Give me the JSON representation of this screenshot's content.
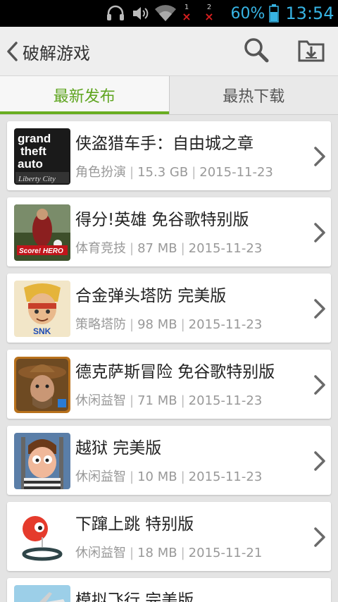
{
  "status_bar": {
    "battery_percent": "60%",
    "time": "13:54",
    "sim1_label": "1",
    "sim2_label": "2",
    "no_signal_mark": "×",
    "icons": [
      "headset-icon",
      "volume-icon",
      "wifi-icon",
      "sim-no-signal-icon",
      "battery-icon"
    ]
  },
  "header": {
    "title": "破解游戏",
    "icons": [
      "back-chevron-icon",
      "search-icon",
      "download-manager-icon"
    ]
  },
  "tabs": [
    {
      "label": "最新发布",
      "active": true
    },
    {
      "label": "最热下载",
      "active": false
    }
  ],
  "games": [
    {
      "title": "侠盗猎车手：自由城之章",
      "category": "角色扮演",
      "size": "15.3 GB",
      "date": "2015-11-23",
      "icon": "gta-liberty-city-icon",
      "icon_text": "grand theft auto"
    },
    {
      "title": "得分!英雄 免谷歌特别版",
      "category": "体育竞技",
      "size": "87 MB",
      "date": "2015-11-23",
      "icon": "score-hero-icon",
      "icon_text": "Score! HERO"
    },
    {
      "title": "合金弹头塔防 完美版",
      "category": "策略塔防",
      "size": "98 MB",
      "date": "2015-11-23",
      "icon": "metal-slug-defense-icon",
      "icon_text": "SNK"
    },
    {
      "title": "德克萨斯冒险 免谷歌特别版",
      "category": "休闲益智",
      "size": "71 MB",
      "date": "2015-11-23",
      "icon": "texas-adventure-icon",
      "icon_text": ""
    },
    {
      "title": "越狱 完美版",
      "category": "休闲益智",
      "size": "10 MB",
      "date": "2015-11-23",
      "icon": "prison-break-icon",
      "icon_text": ""
    },
    {
      "title": "下蹿上跳 特别版",
      "category": "休闲益智",
      "size": "18 MB",
      "date": "2015-11-21",
      "icon": "jump-bird-icon",
      "icon_text": ""
    },
    {
      "title": "模拟飞行 完美版",
      "category": "",
      "size": "",
      "date": "",
      "icon": "flight-sim-icon",
      "icon_text": ""
    }
  ],
  "colors": {
    "accent_green": "#69ad21",
    "status_blue": "#37b4e4",
    "background": "#e4e4e4"
  }
}
